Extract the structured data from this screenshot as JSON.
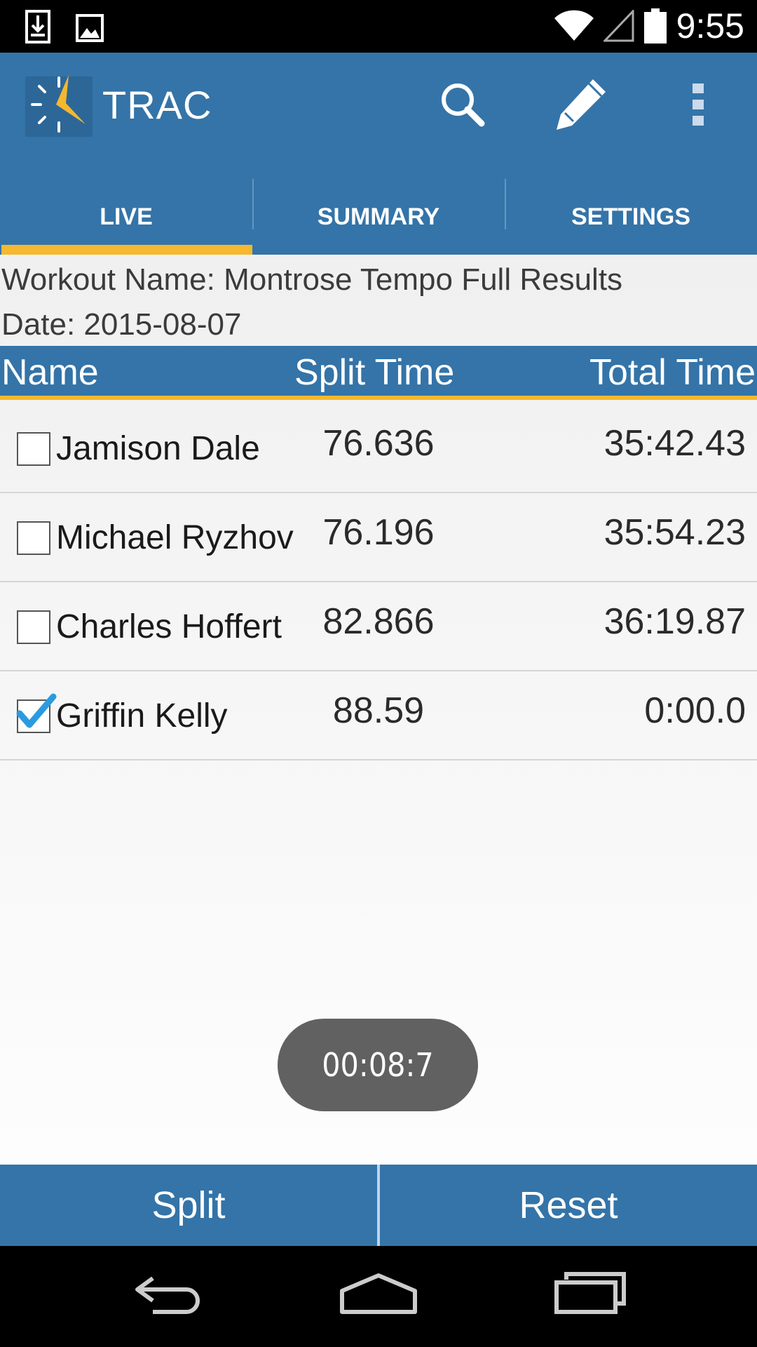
{
  "status_bar": {
    "time": "9:55"
  },
  "app": {
    "title": "TRAC"
  },
  "tabs": [
    {
      "label": "LIVE"
    },
    {
      "label": "SUMMARY"
    },
    {
      "label": "SETTINGS"
    }
  ],
  "workout": {
    "name_line": "Workout Name: Montrose Tempo Full Results",
    "date_line": "Date: 2015-08-07"
  },
  "table": {
    "headers": {
      "name": "Name",
      "split": "Split Time",
      "total": "Total Time"
    },
    "rows": [
      {
        "name": "Jamison Dale",
        "split": "76.636",
        "total": "35:42.43",
        "checked": false
      },
      {
        "name": "Michael Ryzhov",
        "split": "76.196",
        "total": "35:54.23",
        "checked": false
      },
      {
        "name": "Charles Hoffert",
        "split": "82.866",
        "total": "36:19.87",
        "checked": false
      },
      {
        "name": "Griffin Kelly",
        "split": "88.59",
        "total": "0:00.0",
        "checked": true
      }
    ]
  },
  "timer": "00:08:7",
  "buttons": {
    "split": "Split",
    "reset": "Reset"
  },
  "colors": {
    "primary": "#3474a8",
    "accent": "#f5b82e",
    "timer_bg": "#616161"
  }
}
